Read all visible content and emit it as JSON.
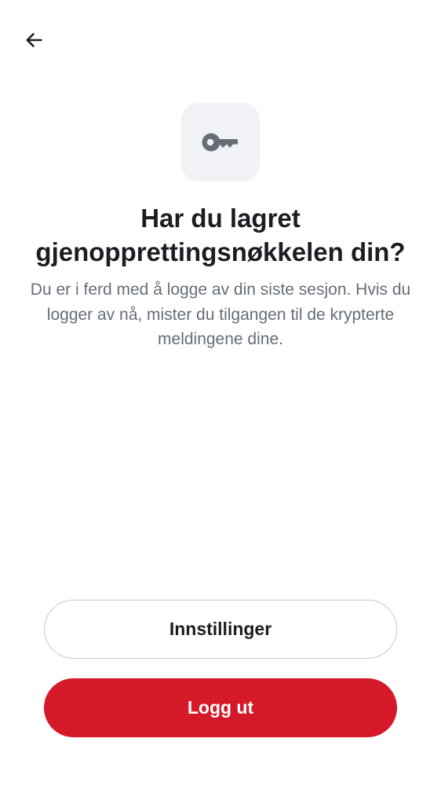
{
  "header": {
    "back_icon": "arrow-left-icon"
  },
  "hero": {
    "icon": "key-icon",
    "title": "Har du lagret gjenopprettingsnøkkelen din?",
    "description": "Du er i ferd med å logge av din siste sesjon. Hvis du logger av nå, mister du tilgangen til de krypterte meldingene dine."
  },
  "actions": {
    "settings_label": "Innstillinger",
    "logout_label": "Logg ut"
  },
  "colors": {
    "primary": "#d51928",
    "text": "#1b1d22",
    "secondary_text": "#656d77",
    "icon_tile": "#f0f2f5",
    "icon": "#656d77"
  }
}
